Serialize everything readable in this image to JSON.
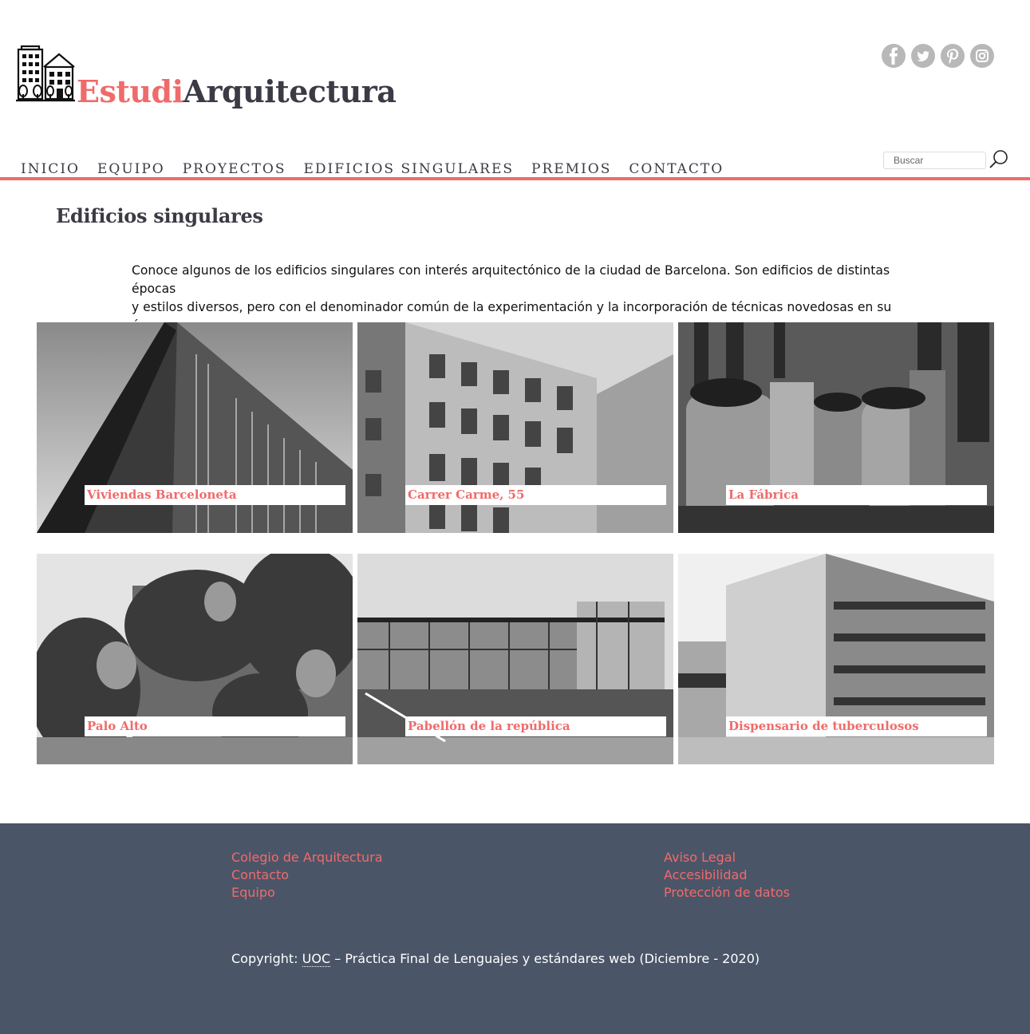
{
  "brand": {
    "part1": "Estudi",
    "part2": "Arquitectura",
    "accent": "#ef6b6b",
    "dark": "#3b3b45"
  },
  "social": [
    {
      "name": "facebook-icon",
      "glyph": "f"
    },
    {
      "name": "twitter-icon",
      "glyph": "t"
    },
    {
      "name": "pinterest-icon",
      "glyph": "p"
    },
    {
      "name": "instagram-icon",
      "glyph": "i"
    }
  ],
  "nav": [
    "INICIO",
    "EQUIPO",
    "PROYECTOS",
    "EDIFICIOS SINGULARES",
    "PREMIOS",
    "CONTACTO"
  ],
  "search": {
    "placeholder": "Buscar"
  },
  "main": {
    "title": "Edificios singulares",
    "intro_line1": "Conoce algunos de los edificios singulares con interés arquitectónico de la ciudad de Barcelona. Son edificios de distintas épocas",
    "intro_line2": "y estilos diversos, pero con el denominador común de la experimentación y la incorporación de técnicas novedosas en su época."
  },
  "buildings": [
    {
      "title": "Viviendas Barceloneta"
    },
    {
      "title": "Carrer Carme, 55"
    },
    {
      "title": "La Fábrica"
    },
    {
      "title": "Palo Alto"
    },
    {
      "title": "Pabellón de la república"
    },
    {
      "title": "Dispensario de tuberculosos"
    }
  ],
  "footer": {
    "links_left": [
      "Colegio de Arquitectura",
      "Contacto",
      "Equipo"
    ],
    "links_right": [
      "Aviso Legal",
      "Accesibilidad",
      "Protección de datos"
    ],
    "copyright_prefix": "Copyright: ",
    "copyright_abbr": "UOC",
    "copyright_suffix": " – Práctica Final de Lenguajes y estándares web (Diciembre - 2020)"
  }
}
